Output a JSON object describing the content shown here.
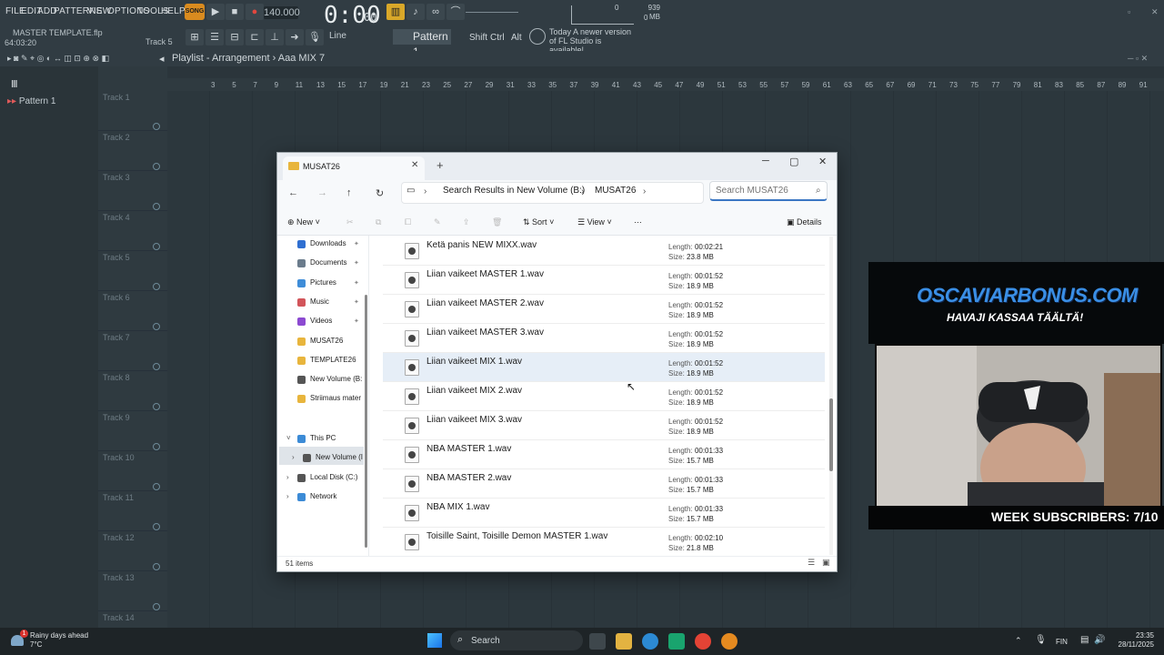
{
  "fl": {
    "menu": [
      "FILE",
      "EDIT",
      "ADD",
      "PATTERNS",
      "VIEW",
      "OPTIONS",
      "TOOLS",
      "HELP"
    ],
    "song_label": "SONG",
    "tempo": "140.000",
    "clock": "0:00",
    "clock_ms": "00",
    "memory": "939 MB",
    "cpu_top": "0",
    "cpu_bottom": "0",
    "file_title": "MASTER TEMPLATE.flp",
    "file_time": "64:03:20",
    "track_hint": "Track 5",
    "line_mode": "Line",
    "pattern_selector": "Pattern 1",
    "shift_label": "Shift",
    "ctrl_label": "Ctrl",
    "alt_label": "Alt",
    "news": "Today  A newer version of FL Studio is available!",
    "playlist_title": "Playlist - Arrangement",
    "playlist_crumb": "Aaa MIX 7",
    "pattern_item": "Pattern 1",
    "tracks": [
      "Track 1",
      "Track 2",
      "Track 3",
      "Track 4",
      "Track 5",
      "Track 6",
      "Track 7",
      "Track 8",
      "Track 9",
      "Track 10",
      "Track 11",
      "Track 12",
      "Track 13",
      "Track 14"
    ],
    "ruler": [
      "3",
      "5",
      "7",
      "9",
      "11",
      "13",
      "15",
      "17",
      "19",
      "21",
      "23",
      "25",
      "27",
      "29",
      "31",
      "33",
      "35",
      "37",
      "39",
      "41",
      "43",
      "45",
      "47",
      "49",
      "51",
      "53",
      "55",
      "57",
      "59",
      "61",
      "63",
      "65",
      "67",
      "69",
      "71",
      "73",
      "75",
      "77",
      "79",
      "81",
      "83",
      "85",
      "87",
      "89",
      "91"
    ]
  },
  "explorer": {
    "tab_title": "MUSAT26",
    "new_tab": "+",
    "breadcrumb": [
      "Search Results in New Volume (B:)",
      "MUSAT26"
    ],
    "search_placeholder": "Search MUSAT26",
    "commands": {
      "new": "New",
      "sort": "Sort",
      "view": "View",
      "more": "···",
      "details": "Details"
    },
    "nav": [
      {
        "label": "Downloads",
        "color": "#2f6fd1",
        "pinned": true
      },
      {
        "label": "Documents",
        "color": "#6b7c8c",
        "pinned": true
      },
      {
        "label": "Pictures",
        "color": "#3f8dd8",
        "pinned": true
      },
      {
        "label": "Music",
        "color": "#d2555a",
        "pinned": true
      },
      {
        "label": "Videos",
        "color": "#8c4ad1",
        "pinned": true
      },
      {
        "label": "MUSAT26",
        "color": "#e8b53d",
        "pinned": false
      },
      {
        "label": "TEMPLATE26",
        "color": "#e8b53d",
        "pinned": false
      },
      {
        "label": "New Volume (B:",
        "color": "#555555",
        "pinned": true
      },
      {
        "label": "Striimaus mater",
        "color": "#e8b53d",
        "pinned": false
      }
    ],
    "tree": [
      {
        "label": "This PC",
        "color": "#3c8bd6"
      },
      {
        "label": "New Volume (I",
        "color": "#555555"
      },
      {
        "label": "Local Disk (C:)",
        "color": "#555555"
      },
      {
        "label": "Network",
        "color": "#3c8bd6"
      }
    ],
    "files": [
      {
        "name": "Ketä panis NEW MIXX.wav",
        "length": "00:02:21",
        "size": "23.8 MB",
        "selected": false
      },
      {
        "name": "Liian vaikeet MASTER 1.wav",
        "length": "00:01:52",
        "size": "18.9 MB",
        "selected": false
      },
      {
        "name": "Liian vaikeet MASTER 2.wav",
        "length": "00:01:52",
        "size": "18.9 MB",
        "selected": false
      },
      {
        "name": "Liian vaikeet MASTER 3.wav",
        "length": "00:01:52",
        "size": "18.9 MB",
        "selected": false
      },
      {
        "name": "Liian vaikeet MIX 1.wav",
        "length": "00:01:52",
        "size": "18.9 MB",
        "selected": true
      },
      {
        "name": "Liian vaikeet MIX 2.wav",
        "length": "00:01:52",
        "size": "18.9 MB",
        "selected": false
      },
      {
        "name": "Liian vaikeet MIX 3.wav",
        "length": "00:01:52",
        "size": "18.9 MB",
        "selected": false
      },
      {
        "name": "NBA MASTER 1.wav",
        "length": "00:01:33",
        "size": "15.7 MB",
        "selected": false
      },
      {
        "name": "NBA MASTER 2.wav",
        "length": "00:01:33",
        "size": "15.7 MB",
        "selected": false
      },
      {
        "name": "NBA MIX 1.wav",
        "length": "00:01:33",
        "size": "15.7 MB",
        "selected": false
      },
      {
        "name": "Toisille Saint, Toisille Demon MASTER 1.wav",
        "length": "00:02:10",
        "size": "21.8 MB",
        "selected": false
      }
    ],
    "length_label": "Length:",
    "size_label": "Size:",
    "item_count": "51 items"
  },
  "overlay": {
    "promo_title": "OSCAVIARBONUS.COM",
    "promo_sub": "HAVAJI KASSAA TÄÄLTÄ!",
    "week": "WEEK SUBSCRIBERS: 7/10"
  },
  "taskbar": {
    "weather_title": "Rainy days ahead",
    "weather_temp": "7°C",
    "search": "Search",
    "lang": "FIN",
    "time": "23:35",
    "date": "28/11/2025"
  }
}
